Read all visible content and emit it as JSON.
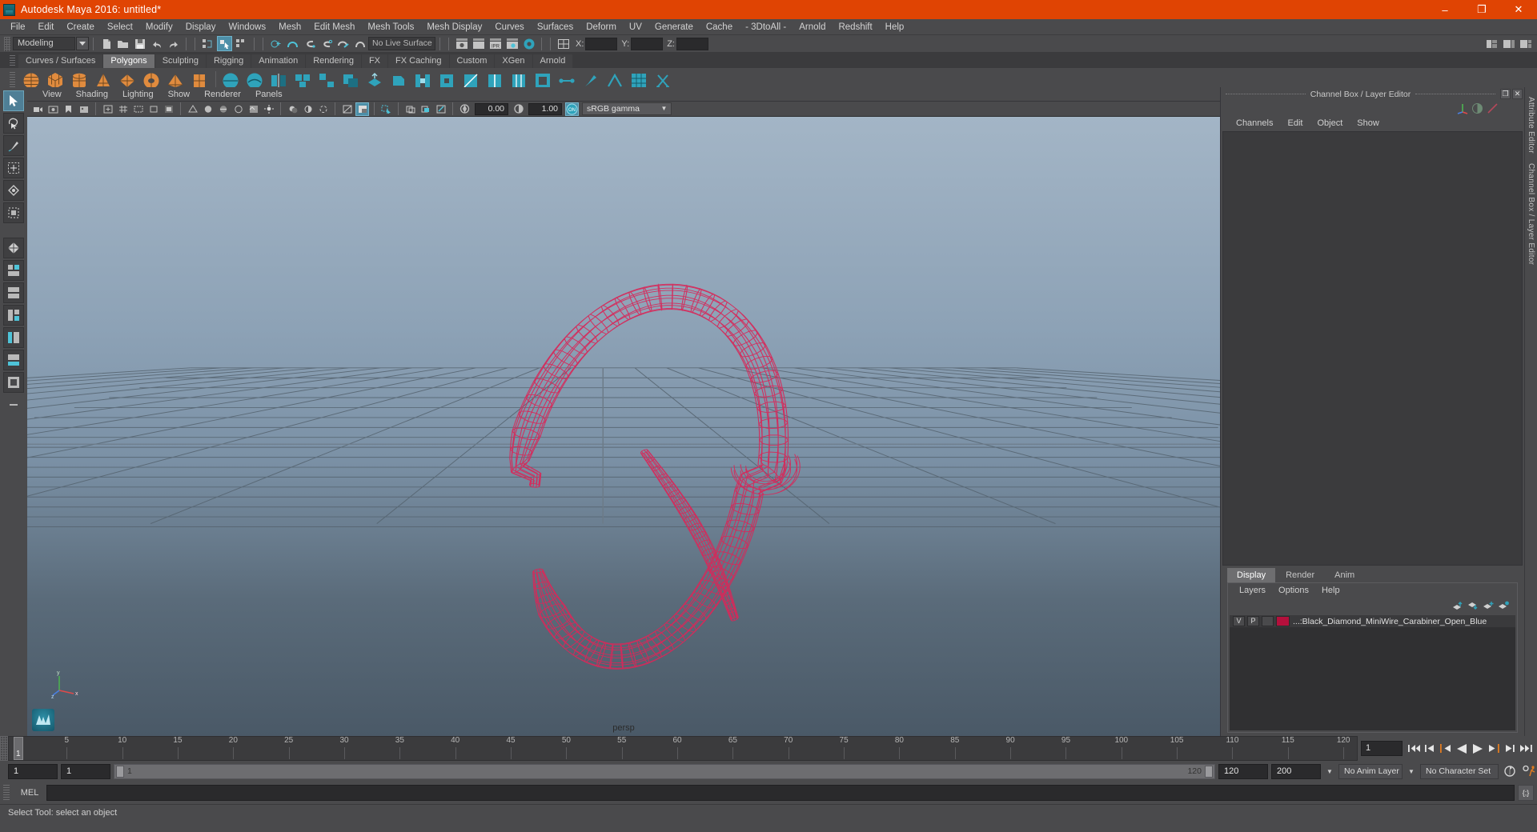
{
  "window": {
    "title": "Autodesk Maya 2016: untitled*",
    "app_icon": "maya-icon",
    "minimize": "–",
    "maximize": "❐",
    "close": "✕",
    "accent_color": "#e04403"
  },
  "menubar": {
    "items": [
      "File",
      "Edit",
      "Create",
      "Select",
      "Modify",
      "Display",
      "Windows",
      "Mesh",
      "Edit Mesh",
      "Mesh Tools",
      "Mesh Display",
      "Curves",
      "Surfaces",
      "Deform",
      "UV",
      "Generate",
      "Cache",
      "- 3DtoAll -",
      "Arnold",
      "Redshift",
      "Help"
    ]
  },
  "statusline": {
    "menu_set": "Modeling",
    "live_surface": "No Live Surface",
    "coord_labels": [
      "X:",
      "Y:",
      "Z:"
    ],
    "coord_values": [
      "",
      "",
      ""
    ]
  },
  "shelf": {
    "tabs": [
      "Curves / Surfaces",
      "Polygons",
      "Sculpting",
      "Rigging",
      "Animation",
      "Rendering",
      "FX",
      "FX Caching",
      "Custom",
      "XGen",
      "Arnold"
    ],
    "active_tab": "Polygons"
  },
  "viewport": {
    "menus": [
      "View",
      "Shading",
      "Lighting",
      "Show",
      "Renderer",
      "Panels"
    ],
    "exposure": "0.00",
    "gamma": "1.00",
    "color_management_toggle": "ON",
    "color_profile": "sRGB gamma",
    "camera_label": "persp",
    "axis_labels": {
      "x": "x",
      "y": "y",
      "z": "z"
    },
    "mesh_color": "#d6295a",
    "grid_color": "#53626f"
  },
  "channel_box": {
    "panel_title": "Channel Box / Layer Editor",
    "menus": [
      "Channels",
      "Edit",
      "Object",
      "Show"
    ],
    "float_button": "❐",
    "close_button": "✕"
  },
  "layer_editor": {
    "tabs": [
      "Display",
      "Render",
      "Anim"
    ],
    "active_tab": "Display",
    "menus": [
      "Layers",
      "Options",
      "Help"
    ],
    "buttons": [
      "move-layer-up-icon",
      "move-layer-down-icon",
      "new-layer-icon",
      "new-layer-from-selected-icon"
    ],
    "layers": [
      {
        "visibility": "V",
        "playback": "P",
        "shading": "",
        "color": "#b4103c",
        "name": "...:Black_Diamond_MiniWire_Carabiner_Open_Blue"
      }
    ]
  },
  "right_vtabs": [
    "Attribute Editor",
    "Channel Box / Layer Editor"
  ],
  "timeline": {
    "ticks": [
      5,
      10,
      15,
      20,
      25,
      30,
      35,
      40,
      45,
      50,
      55,
      60,
      65,
      70,
      75,
      80,
      85,
      90,
      95,
      100,
      105,
      110,
      115,
      120
    ],
    "start": 1,
    "end": 120,
    "current_frame_marker": "1",
    "current_frame_field": "1"
  },
  "range_slider": {
    "anim_start": "1",
    "range_start": "1",
    "bar_left_label": "1",
    "bar_right_label": "120",
    "range_end": "120",
    "anim_end": "200",
    "anim_layer": "No Anim Layer",
    "character_set": "No Character Set"
  },
  "playback": {
    "buttons": [
      "go-to-start-icon",
      "step-back-keyframe-icon",
      "step-back-frame-icon",
      "play-backwards-icon",
      "play-forwards-icon",
      "step-forward-frame-icon",
      "step-forward-keyframe-icon",
      "go-to-end-icon"
    ]
  },
  "command_line": {
    "language_label": "MEL",
    "value": "",
    "script_editor_button": "{;}"
  },
  "help_line": {
    "text": "Select Tool: select an object"
  }
}
